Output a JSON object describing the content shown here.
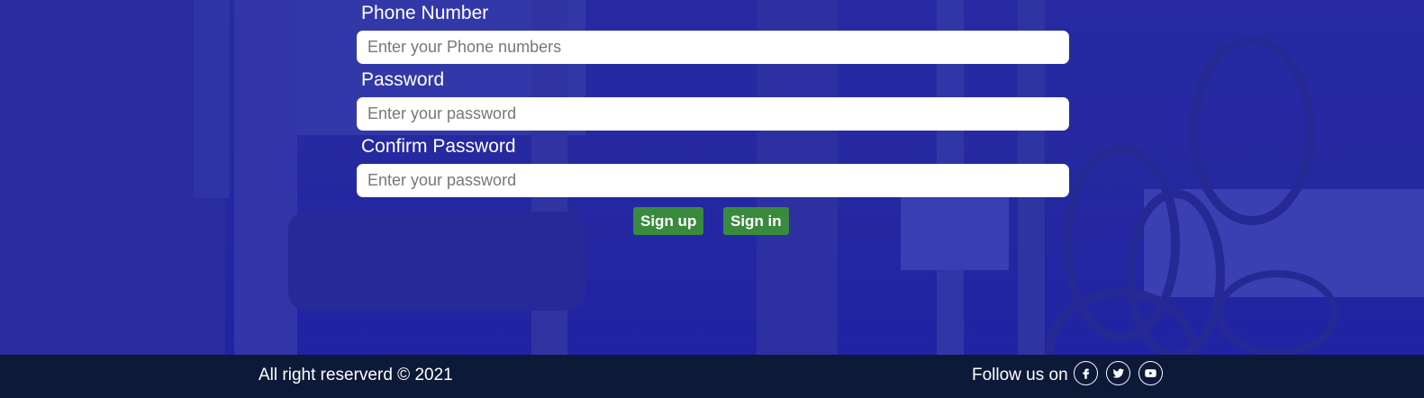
{
  "form": {
    "phone": {
      "label": "Phone Number",
      "placeholder": "Enter your Phone numbers",
      "value": ""
    },
    "password": {
      "label": "Password",
      "placeholder": "Enter your password",
      "value": ""
    },
    "confirm_password": {
      "label": "Confirm Password",
      "placeholder": "Enter your password",
      "value": ""
    },
    "signup_label": "Sign up",
    "signin_label": "Sign in"
  },
  "footer": {
    "copyright": "All right reserverd © 2021",
    "follow_text": "Follow us on",
    "social_icons": [
      "facebook-icon",
      "twitter-icon",
      "youtube-icon"
    ]
  },
  "colors": {
    "overlay": "#24279a",
    "button": "#3a8a3e",
    "footer": "#0c1937"
  }
}
